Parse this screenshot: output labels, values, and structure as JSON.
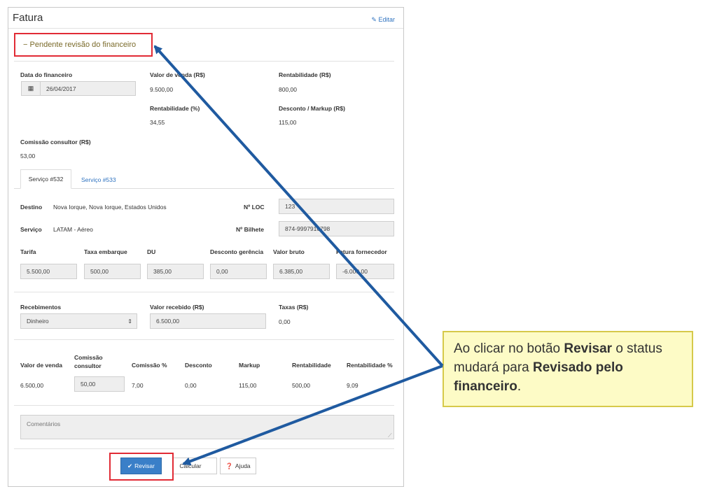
{
  "header": {
    "title": "Fatura",
    "edit_label": "Editar"
  },
  "status": {
    "text": "Pendente revisão do financeiro"
  },
  "finance": {
    "data_label": "Data do financeiro",
    "data_value": "26/04/2017",
    "valor_venda_label": "Valor de venda (R$)",
    "valor_venda_value": "9.500,00",
    "rentabilidade_label": "Rentabilidade (R$)",
    "rentabilidade_value": "800,00",
    "rent_pct_label": "Rentabilidade (%)",
    "rent_pct_value": "34,55",
    "desconto_label": "Desconto / Markup (R$)",
    "desconto_value": "115,00",
    "comissao_label": "Comissão consultor (R$)",
    "comissao_value": "53,00"
  },
  "tabs": [
    {
      "label": "Serviço #532"
    },
    {
      "label": "Serviço #533"
    }
  ],
  "service": {
    "destino_label": "Destino",
    "destino_value": "Nova Iorque, Nova Iorque, Estados Unidos",
    "loc_label": "Nº LOC",
    "loc_value": "123",
    "servico_label": "Serviço",
    "servico_value": "LATAM - Aéreo",
    "bilhete_label": "Nº Bilhete",
    "bilhete_value": "874-9997910798"
  },
  "fares": {
    "headers": [
      "Tarifa",
      "Taxa embarque",
      "DU",
      "Desconto gerência",
      "Valor bruto",
      "Fatura fornecedor"
    ],
    "values": [
      "5.500,00",
      "500,00",
      "385,00",
      "0,00",
      "6.385,00",
      "-6.000,00"
    ]
  },
  "receipts": {
    "recebimentos_label": "Recebimentos",
    "recebimentos_value": "Dinheiro",
    "valor_recebido_label": "Valor recebido (R$)",
    "valor_recebido_value": "6.500,00",
    "taxas_label": "Taxas (R$)",
    "taxas_value": "0,00"
  },
  "summary": {
    "headers": [
      "Valor de venda",
      "Comissão consultor",
      "Comissão %",
      "Desconto",
      "Markup",
      "Rentabilidade",
      "Rentabilidade %"
    ],
    "values": [
      "6.500,00",
      "50,00",
      "7,00",
      "0,00",
      "115,00",
      "500,00",
      "9,09"
    ]
  },
  "comments": {
    "placeholder": "Comentários"
  },
  "buttons": {
    "revisar": "Revisar",
    "calcular": "Calcular",
    "ajuda": "Ajuda"
  },
  "callout": {
    "part1": "Ao clicar no botão ",
    "bold1": "Revisar",
    "part2": " o status mudará para ",
    "bold2": "Revisado pelo financeiro",
    "part3": "."
  },
  "colors": {
    "accent": "#2f73c0",
    "highlight": "#e12b35",
    "arrow": "#1f5aa0",
    "callout_bg": "#fdfbc6",
    "status_text": "#7a6a2a"
  }
}
